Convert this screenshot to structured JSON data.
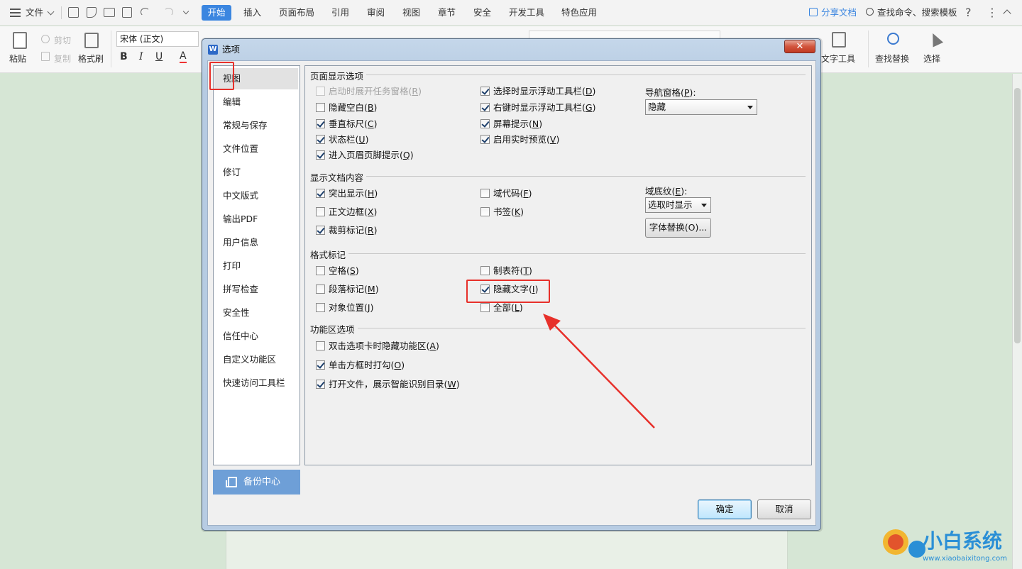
{
  "menubar": {
    "file_label": "文件",
    "tabs": [
      "开始",
      "插入",
      "页面布局",
      "引用",
      "审阅",
      "视图",
      "章节",
      "安全",
      "开发工具",
      "特色应用"
    ],
    "active_tab": "开始",
    "share_label": "分享文档",
    "search_label": "查找命令、搜索模板"
  },
  "ribbon": {
    "paste": "粘贴",
    "cut": "剪切",
    "copy": "复制",
    "format_painter": "格式刷",
    "font_name": "宋体 (正文)",
    "bold": "B",
    "italic": "I",
    "underline": "U",
    "font_color": "A",
    "text_tools": "文字工具",
    "find_replace": "查找替换",
    "select": "选择"
  },
  "dialog": {
    "title": "选项",
    "logo_letter": "W",
    "close_label": "✕",
    "nav_items": [
      "视图",
      "编辑",
      "常规与保存",
      "文件位置",
      "修订",
      "中文版式",
      "输出PDF",
      "用户信息",
      "打印",
      "拼写检查",
      "安全性",
      "信任中心",
      "自定义功能区",
      "快速访问工具栏"
    ],
    "active_nav": "视图",
    "backup_label": "备份中心",
    "ok_label": "确定",
    "cancel_label": "取消",
    "sections": {
      "page_display": {
        "title": "页面显示选项",
        "items": [
          {
            "label": "启动时展开任务窗格",
            "key": "R",
            "checked": false,
            "disabled": true
          },
          {
            "label": "隐藏空白",
            "key": "B",
            "checked": false
          },
          {
            "label": "垂直标尺",
            "key": "C",
            "checked": true
          },
          {
            "label": "状态栏",
            "key": "U",
            "checked": true
          },
          {
            "label": "进入页眉页脚提示",
            "key": "Q",
            "checked": true
          },
          {
            "label": "选择时显示浮动工具栏",
            "key": "D",
            "checked": true
          },
          {
            "label": "右键时显示浮动工具栏",
            "key": "G",
            "checked": true
          },
          {
            "label": "屏幕提示",
            "key": "N",
            "checked": true
          },
          {
            "label": "启用实时预览",
            "key": "V",
            "checked": true
          }
        ],
        "nav_pane_label": "导航窗格(",
        "nav_pane_key": "P",
        "nav_pane_suffix": "):",
        "nav_pane_value": "隐藏"
      },
      "doc_content": {
        "title": "显示文档内容",
        "items": [
          {
            "label": "突出显示",
            "key": "H",
            "checked": true
          },
          {
            "label": "正文边框",
            "key": "X",
            "checked": false
          },
          {
            "label": "裁剪标记",
            "key": "R",
            "checked": true
          },
          {
            "label": "域代码",
            "key": "F",
            "checked": false
          },
          {
            "label": "书签",
            "key": "K",
            "checked": false
          }
        ],
        "field_shading_label": "域底纹(",
        "field_shading_key": "E",
        "field_shading_suffix": "):",
        "field_shading_value": "选取时显示",
        "font_sub_button": "字体替换(O)..."
      },
      "format_marks": {
        "title": "格式标记",
        "items": [
          {
            "label": "空格",
            "key": "S",
            "checked": false
          },
          {
            "label": "段落标记",
            "key": "M",
            "checked": false
          },
          {
            "label": "对象位置",
            "key": "J",
            "checked": false
          },
          {
            "label": "制表符",
            "key": "T",
            "checked": false
          },
          {
            "label": "隐藏文字",
            "key": "I",
            "checked": true
          },
          {
            "label": "全部",
            "key": "L",
            "checked": false
          }
        ]
      },
      "ribbon_options": {
        "title": "功能区选项",
        "items": [
          {
            "label": "双击选项卡时隐藏功能区",
            "key": "A",
            "checked": false
          },
          {
            "label": "单击方框时打勾",
            "key": "O",
            "checked": true
          },
          {
            "label": "打开文件，展示智能识别目录",
            "key": "W",
            "checked": true
          }
        ]
      }
    }
  },
  "watermark": {
    "text": "小白系统",
    "url": "www.xiaobaixitong.com"
  },
  "colors": {
    "accent": "#3b86e0",
    "annotation_red": "#e7302a",
    "doc_bg": "#d6e6d5"
  }
}
